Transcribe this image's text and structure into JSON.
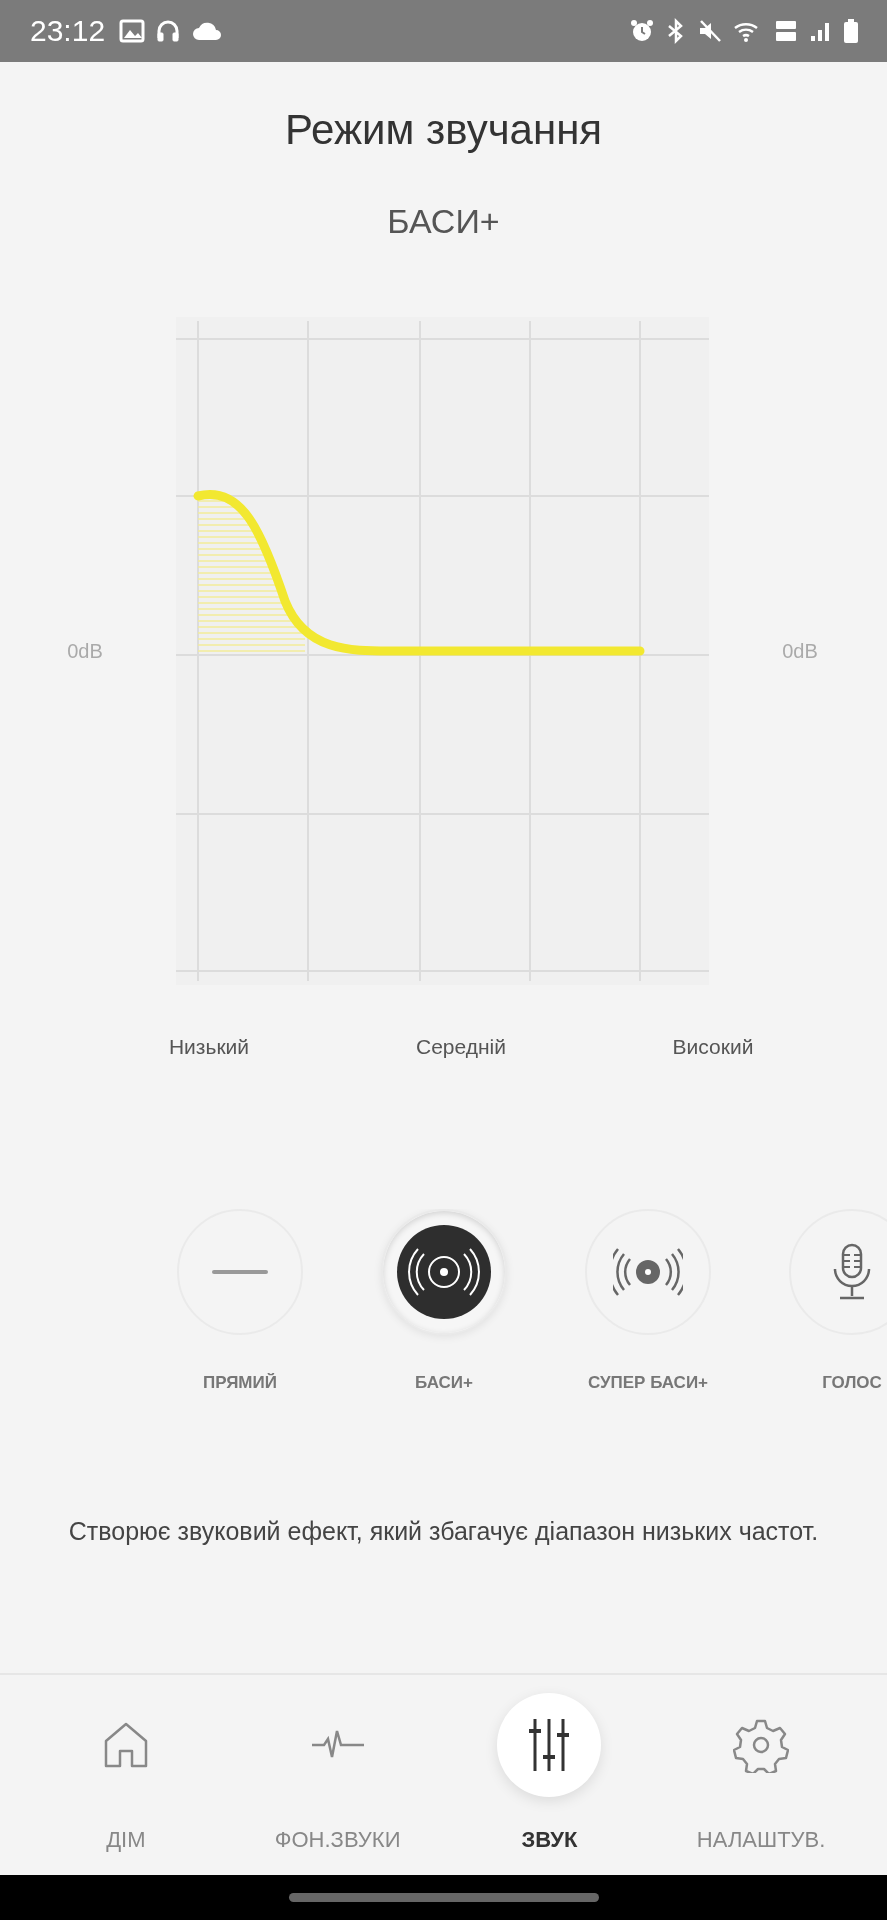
{
  "status_bar": {
    "time": "23:12"
  },
  "title": "Режим звучання",
  "current_mode": "БАСИ+",
  "eq": {
    "left_label": "0dB",
    "right_label": "0dB",
    "bands": [
      "Низький",
      "Середній",
      "Високий"
    ]
  },
  "modes": [
    {
      "kind": "flat",
      "label": "ПРЯМИЙ",
      "selected": false
    },
    {
      "kind": "bass",
      "label": "БАСИ+",
      "selected": true
    },
    {
      "kind": "super_bass",
      "label": "СУПЕР БАСИ+",
      "selected": false
    },
    {
      "kind": "voice",
      "label": "ГОЛОС",
      "selected": false
    }
  ],
  "description": "Створює звуковий ефект, який збагачує діапазон низьких частот.",
  "nav": [
    {
      "kind": "home",
      "label": "ДІМ",
      "selected": false
    },
    {
      "kind": "ambient",
      "label": "ФОН.ЗВУКИ",
      "selected": false
    },
    {
      "kind": "sound",
      "label": "ЗВУК",
      "selected": true
    },
    {
      "kind": "settings",
      "label": "НАЛАШТУВ.",
      "selected": false
    }
  ]
}
